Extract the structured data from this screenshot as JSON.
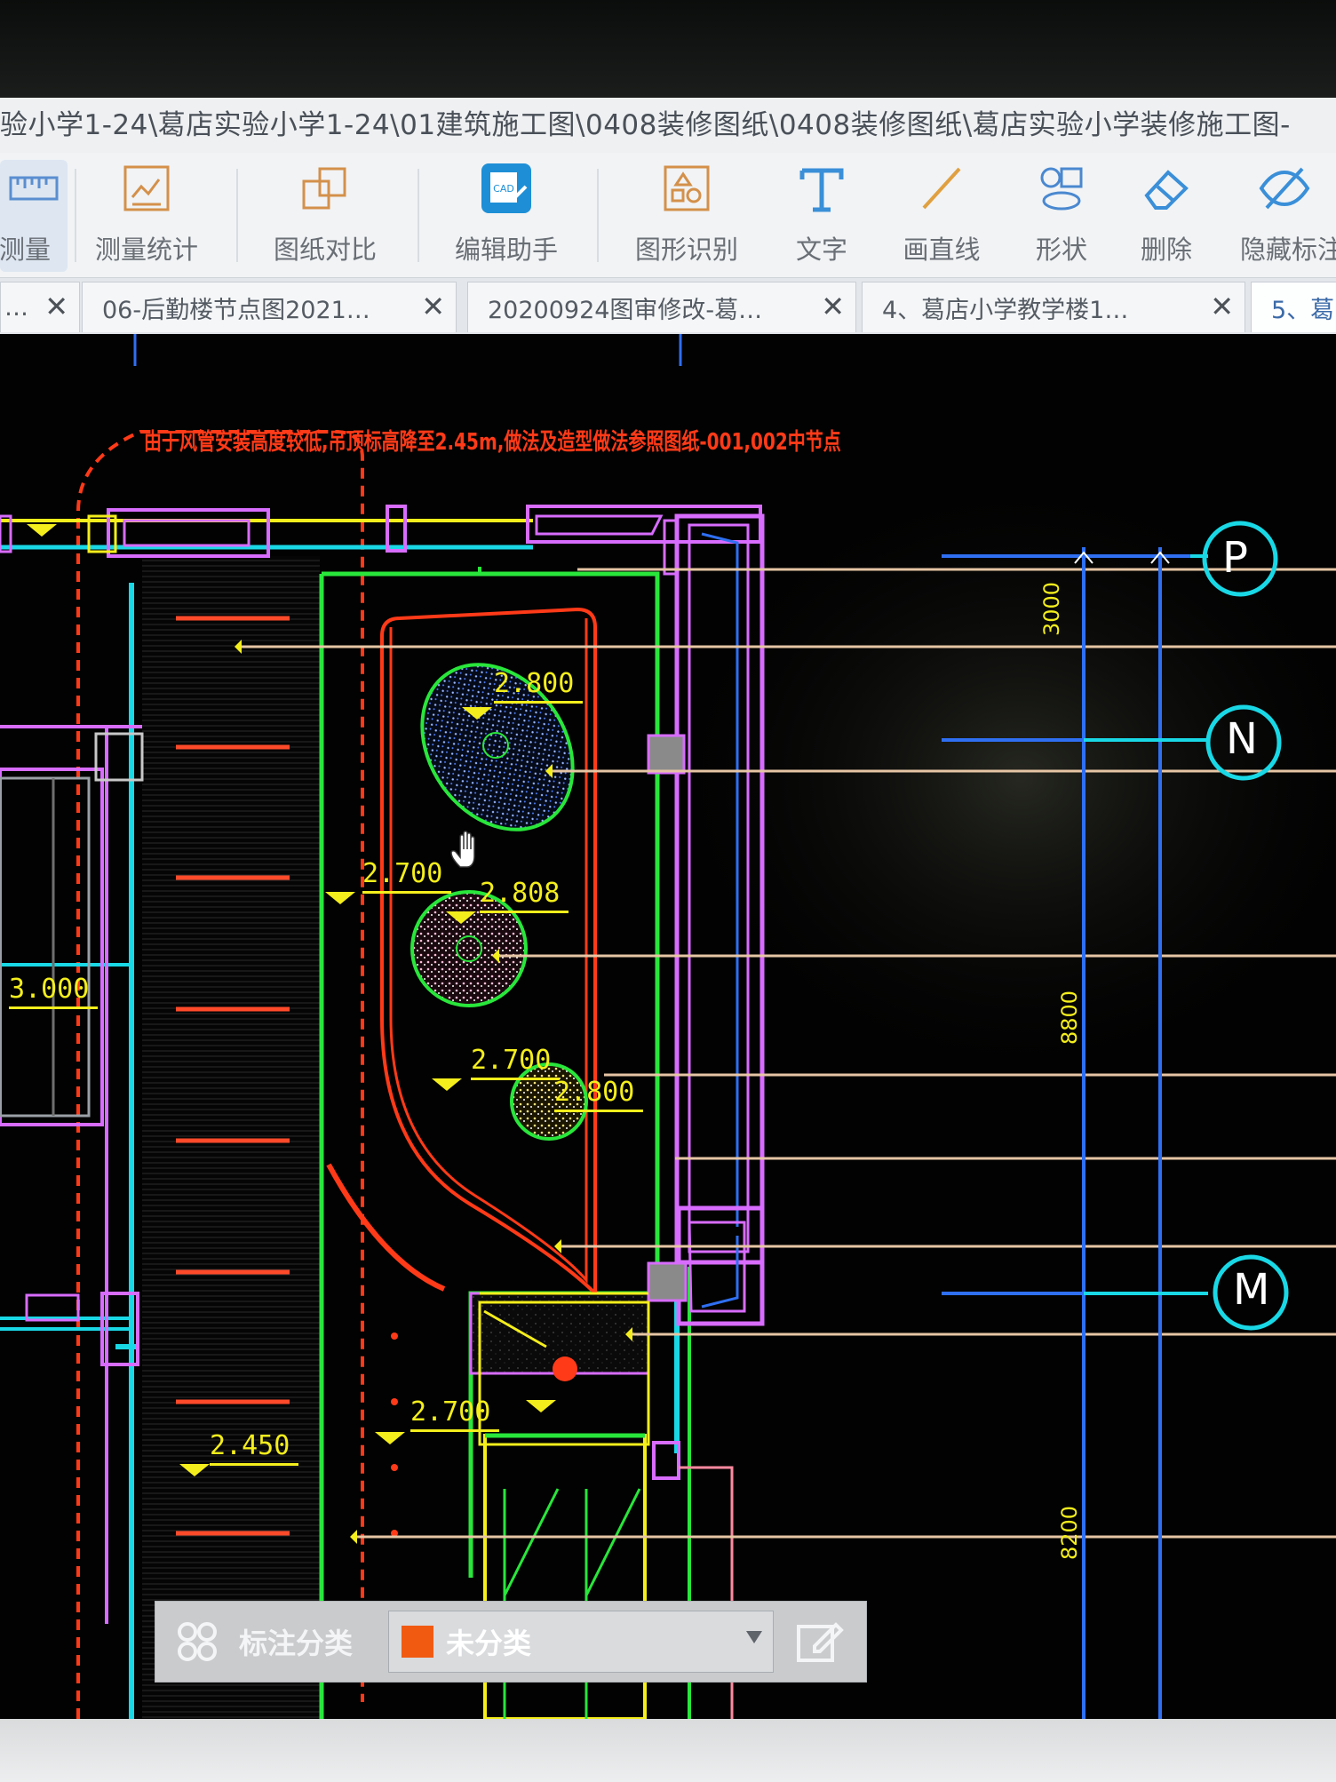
{
  "window": {
    "title_path": "验小学1-24\\葛店实验小学1-24\\01建筑施工图\\0408装修图纸\\0408装修图纸\\葛店实验小学装修施工图-"
  },
  "toolbar": {
    "items": [
      {
        "label": "测量",
        "icon": "ruler-icon"
      },
      {
        "label": "测量统计",
        "icon": "measure-stats-icon"
      },
      {
        "label": "图纸对比",
        "icon": "compare-icon"
      },
      {
        "label": "编辑助手",
        "icon": "cad-edit-icon"
      },
      {
        "label": "图形识别",
        "icon": "shape-recognize-icon"
      },
      {
        "label": "文字",
        "icon": "text-icon"
      },
      {
        "label": "画直线",
        "icon": "line-icon"
      },
      {
        "label": "形状",
        "icon": "shapes-icon"
      },
      {
        "label": "删除",
        "icon": "eraser-icon"
      },
      {
        "label": "隐藏标注",
        "icon": "eye-hide-icon"
      }
    ]
  },
  "tabs": [
    {
      "label": "…",
      "close": "✕"
    },
    {
      "label": "06-后勤楼节点图2021…",
      "close": "✕"
    },
    {
      "label": "20200924图审修改-葛…",
      "close": "✕"
    },
    {
      "label": "4、葛店小学教学楼1…",
      "close": "✕"
    },
    {
      "label": "5、葛",
      "close": ""
    }
  ],
  "drawing": {
    "note": "由于风管安装高度较低,吊顶标高降至2.45m,做法及造型做法参照图纸-001,002中节点",
    "elevations": [
      "2.800",
      "2.700",
      "2.808",
      "2.700",
      "2.800",
      "3.000",
      "2.700",
      "2.450"
    ],
    "axis_labels": [
      "P",
      "N",
      "M"
    ],
    "dimensions": [
      "3000",
      "8800",
      "8200"
    ],
    "colors": {
      "background": "#020202",
      "green": "#29e63b",
      "magenta": "#d86cff",
      "yellow": "#f4ee1c",
      "red": "#ff3a18",
      "cyan": "#19d8e6",
      "blue": "#2f6ff2",
      "tan": "#e6c5a4"
    }
  },
  "annotation_bar": {
    "grid_icon": "grid-icon",
    "category_label": "标注分类",
    "selected_category": "未分类",
    "swatch_color": "#f15a11",
    "edit_icon": "edit-icon"
  }
}
